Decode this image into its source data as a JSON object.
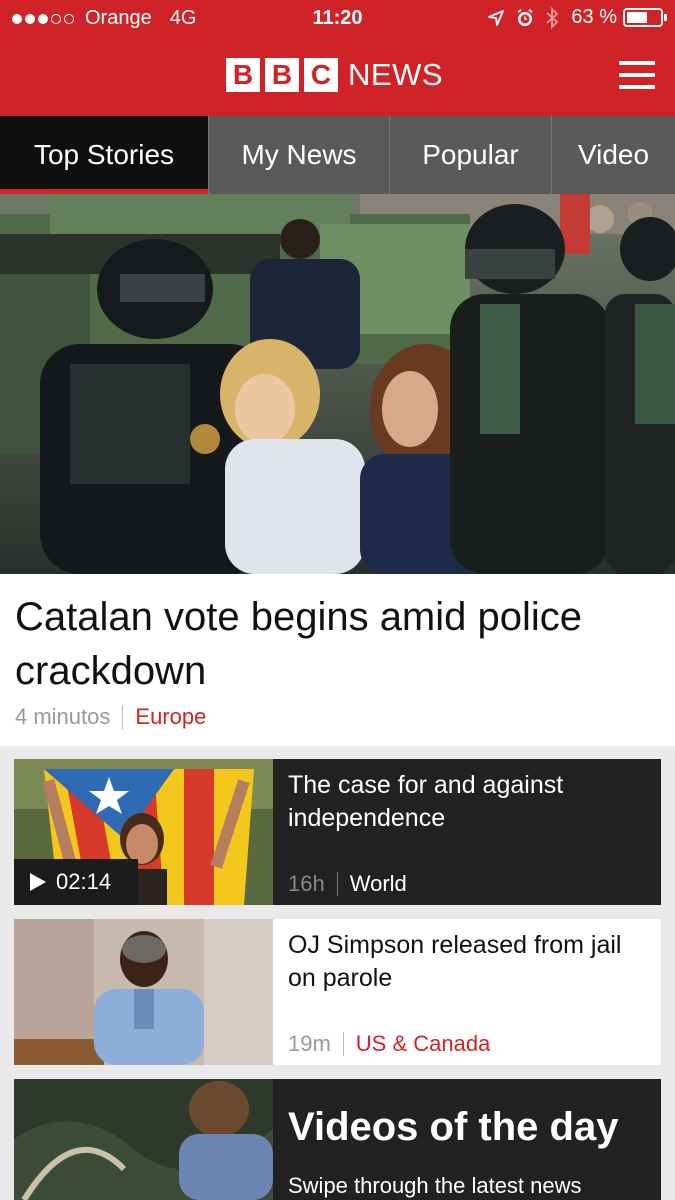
{
  "status_bar": {
    "carrier": "Orange",
    "network": "4G",
    "time": "11:20",
    "battery_percent": "63 %",
    "battery_level": 0.63
  },
  "header": {
    "logo_letters": [
      "B",
      "B",
      "C"
    ],
    "logo_text": "NEWS",
    "brand_color": "#cf2328"
  },
  "tabs": [
    {
      "label": "Top Stories",
      "active": true
    },
    {
      "label": "My News",
      "active": false
    },
    {
      "label": "Popular",
      "active": false
    },
    {
      "label": "Video",
      "active": false
    }
  ],
  "hero": {
    "title": "Catalan vote begins amid police crackdown",
    "time": "4 minutos",
    "section": "Europe"
  },
  "stories": [
    {
      "title": "The case for and against independence",
      "time": "16h",
      "section": "World",
      "video_duration": "02:14",
      "theme": "dark"
    },
    {
      "title": "OJ Simpson released from jail on parole",
      "time": "19m",
      "section": "US & Canada",
      "theme": "light"
    }
  ],
  "videos_promo": {
    "title": "Videos of the day",
    "subtitle": "Swipe through the latest news"
  }
}
